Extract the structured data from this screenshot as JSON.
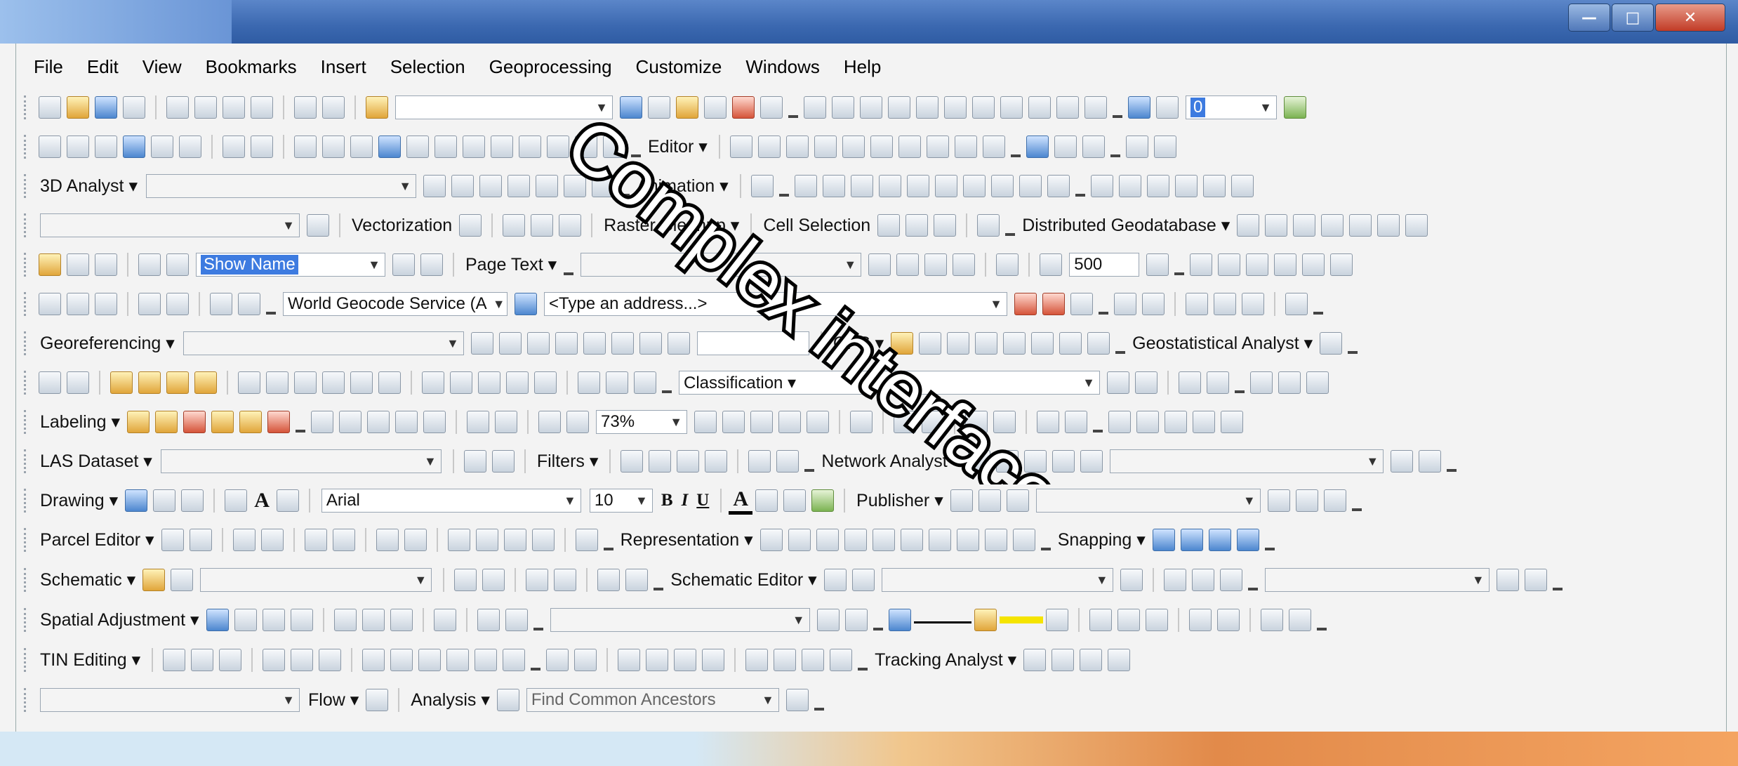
{
  "window": {
    "min": "—",
    "max": "□",
    "close": "✕"
  },
  "menu": [
    "File",
    "Edit",
    "View",
    "Bookmarks",
    "Insert",
    "Selection",
    "Geoprocessing",
    "Customize",
    "Windows",
    "Help"
  ],
  "overlay_text": "Complex interface",
  "rows": {
    "r2": {
      "page_value": "0"
    },
    "r3": {
      "editor": "Editor ▾"
    },
    "r4": {
      "analyst": "3D Analyst ▾",
      "animation": "Animation ▾"
    },
    "r5": {
      "vectorization": "Vectorization",
      "raster": "Raster Cleanup ▾",
      "cell": "Cell Selection",
      "distributed": "Distributed Geodatabase ▾"
    },
    "r6": {
      "show_name": "Show Name",
      "page_text": "Page Text ▾",
      "scale": "500"
    },
    "r7": {
      "geocode": "World Geocode Service (A",
      "address": "<Type an address...>"
    },
    "r8": {
      "georef": "Georeferencing ▾",
      "gps": "GPS ▾",
      "geostat": "Geostatistical Analyst ▾"
    },
    "r9": {
      "classification": "Classification ▾"
    },
    "r10": {
      "labeling": "Labeling ▾",
      "zoom": "73%"
    },
    "r11": {
      "las": "LAS Dataset ▾",
      "filters": "Filters ▾",
      "network": "Network Analyst ▾"
    },
    "r12": {
      "drawing": "Drawing ▾",
      "font": "Arial",
      "size": "10",
      "bold": "B",
      "italic": "I",
      "underline": "U",
      "fontcolor": "A",
      "publisher": "Publisher ▾"
    },
    "r13": {
      "parcel": "Parcel Editor ▾",
      "representation": "Representation ▾",
      "snapping": "Snapping ▾"
    },
    "r14": {
      "schematic": "Schematic ▾",
      "schematic_editor": "Schematic Editor ▾"
    },
    "r15": {
      "spatial": "Spatial Adjustment ▾"
    },
    "r16": {
      "tin": "TIN Editing ▾",
      "tracking": "Tracking Analyst ▾"
    },
    "r17": {
      "flow": "Flow ▾",
      "analysis": "Analysis ▾",
      "ancestors": "Find Common Ancestors"
    }
  }
}
